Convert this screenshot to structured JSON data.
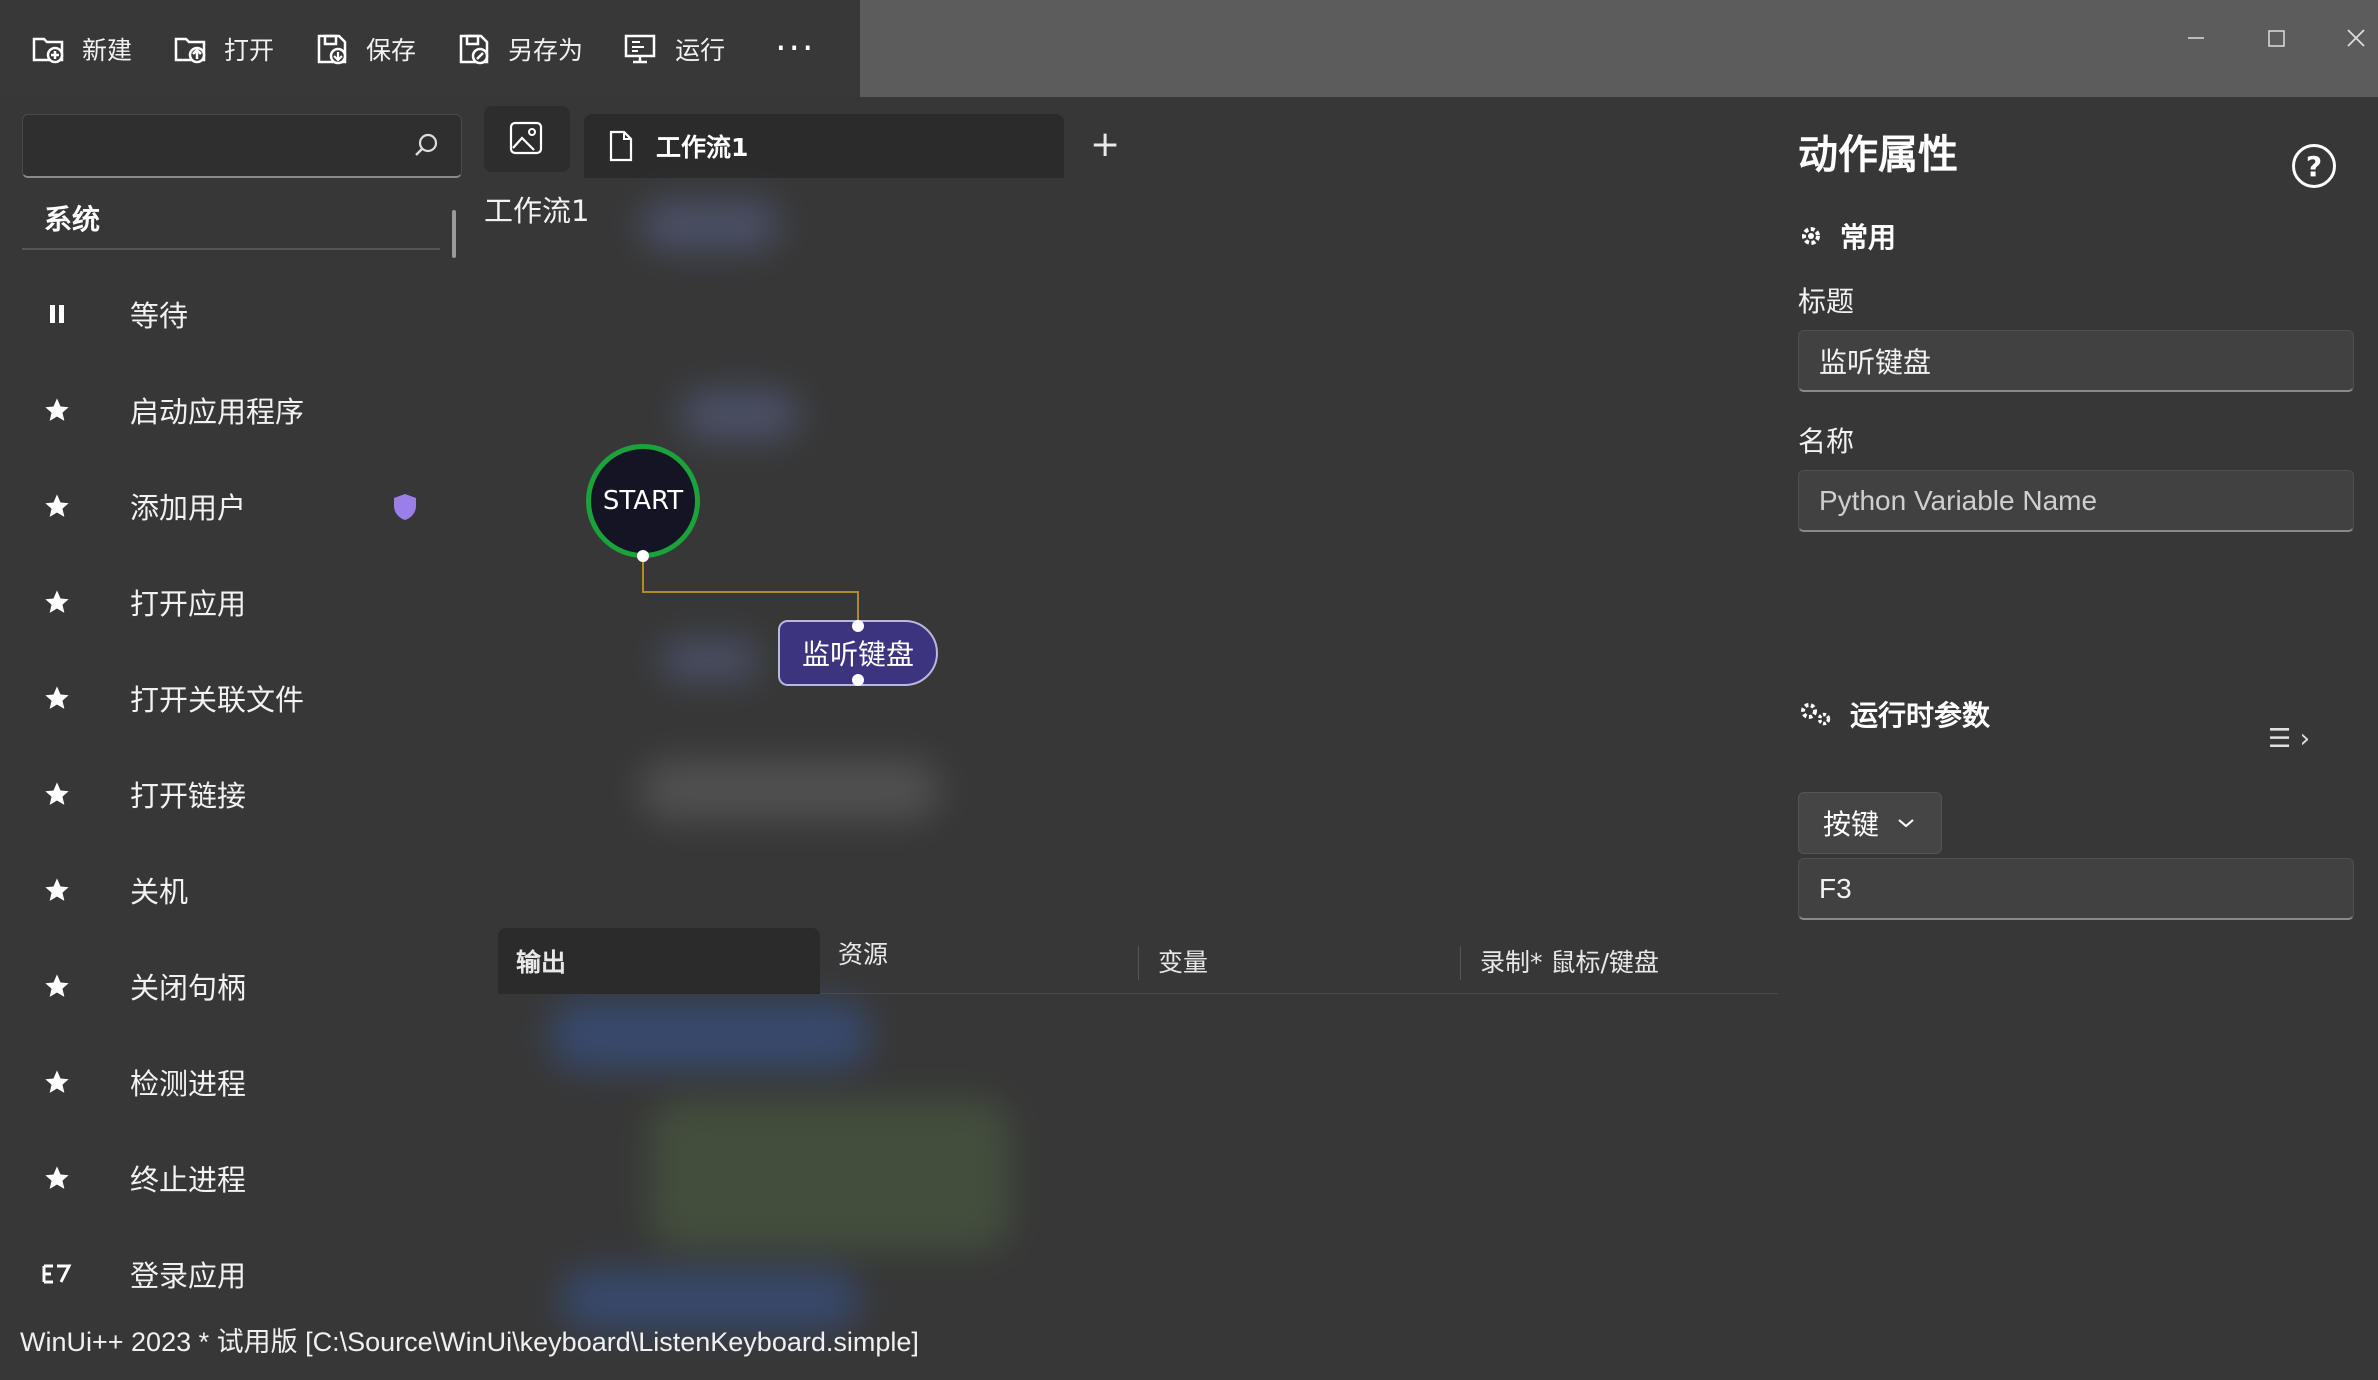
{
  "toolbar": {
    "new": "新建",
    "open": "打开",
    "save": "保存",
    "save_as": "另存为",
    "run": "运行",
    "more": "···"
  },
  "left_panel": {
    "search_placeholder": "",
    "category": "系统",
    "actions": [
      {
        "label": "等待",
        "icon": "pause-icon"
      },
      {
        "label": "启动应用程序",
        "icon": "star-icon"
      },
      {
        "label": "添加用户",
        "icon": "star-icon",
        "badge": "shield-icon"
      },
      {
        "label": "打开应用",
        "icon": "star-icon"
      },
      {
        "label": "打开关联文件",
        "icon": "star-icon"
      },
      {
        "label": "打开链接",
        "icon": "star-icon"
      },
      {
        "label": "关机",
        "icon": "star-icon"
      },
      {
        "label": "关闭句柄",
        "icon": "star-icon"
      },
      {
        "label": "检测进程",
        "icon": "star-icon"
      },
      {
        "label": "终止进程",
        "icon": "star-icon"
      },
      {
        "label": "登录应用",
        "icon": "login-icon"
      }
    ]
  },
  "center": {
    "tab_label": "工作流1",
    "add_tab": "+",
    "workflow_title": "工作流1",
    "start_node": "START",
    "action_node": "监听键盘",
    "bottom_tabs": [
      "输出",
      "资源",
      "变量",
      "录制* 鼠标/键盘"
    ]
  },
  "right_panel": {
    "title": "动作属性",
    "help": "?",
    "section_common": "常用",
    "title_label": "标题",
    "title_value": "监听键盘",
    "name_label": "名称",
    "name_placeholder": "Python Variable Name",
    "section_runtime": "运行时参数",
    "key_dropdown": "按键",
    "key_value": "F3"
  },
  "status_bar": "WinUi++ 2023 * 试用版 [C:\\Source\\WinUi\\keyboard\\ListenKeyboard.simple]",
  "colors": {
    "background": "#373737",
    "start_border": "#1aa33a",
    "node_fill": "#3d3480",
    "badge": "#9b7fe8"
  }
}
